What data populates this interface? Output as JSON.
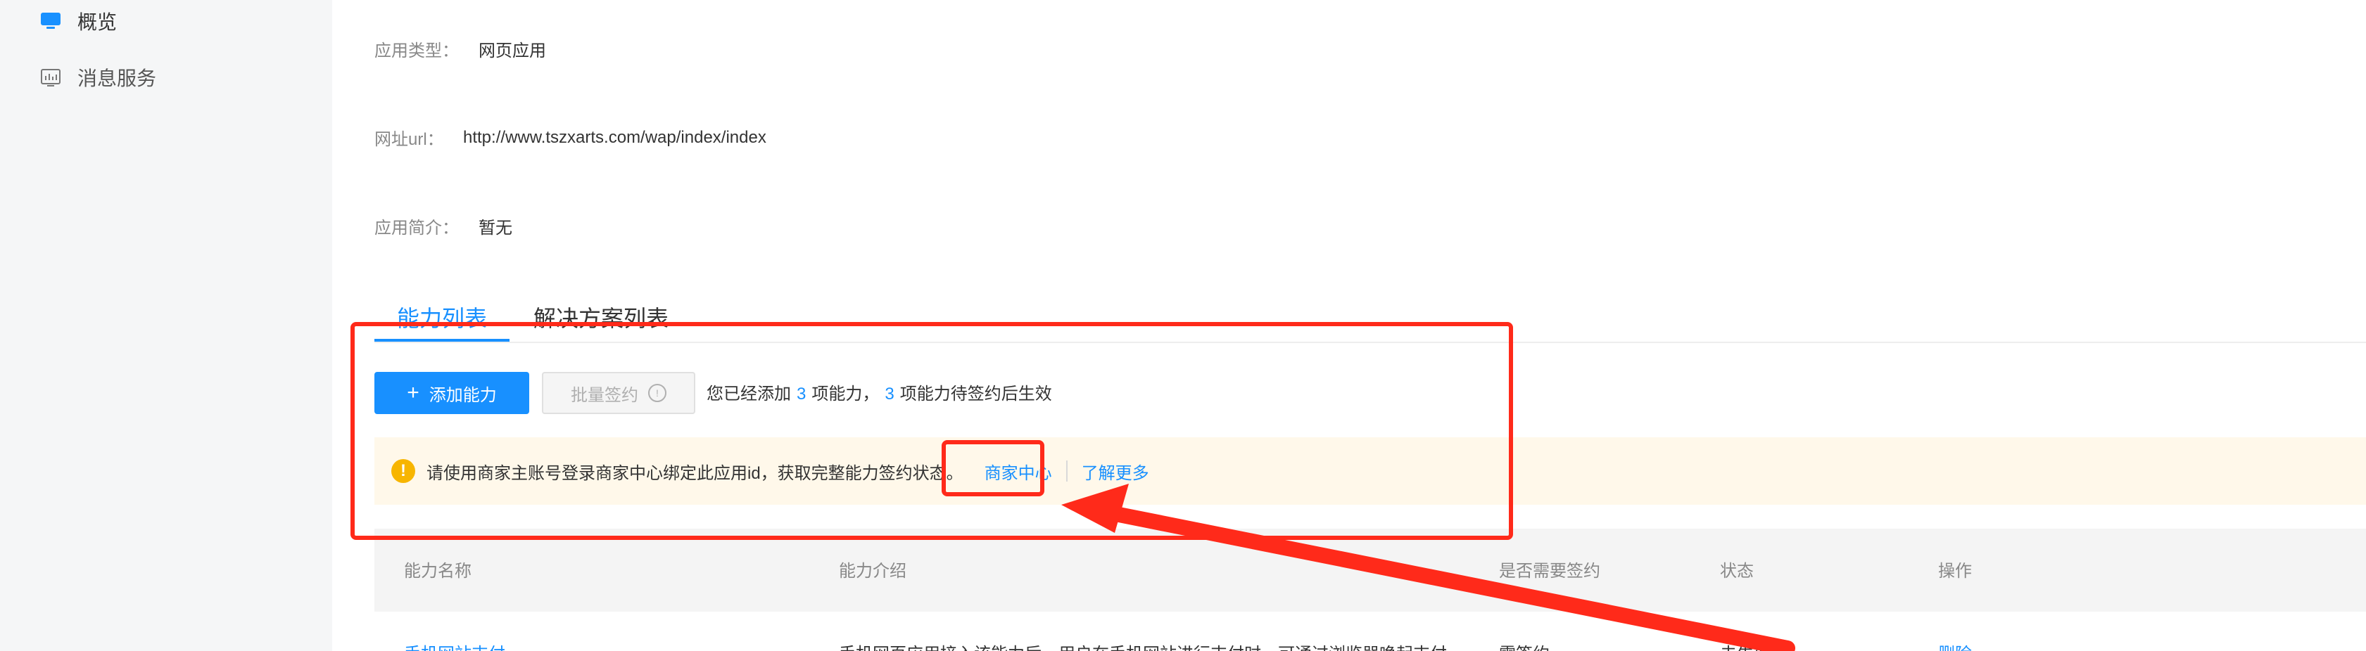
{
  "sidebar": {
    "items": [
      {
        "label": "概览",
        "icon": "monitor-icon"
      },
      {
        "label": "消息服务",
        "icon": "chart-icon"
      }
    ]
  },
  "app_info": {
    "type_label": "应用类型：",
    "type_value": "网页应用",
    "url_label": "网址url：",
    "url_value": "http://www.tszxarts.com/wap/index/index",
    "intro_label": "应用简介：",
    "intro_value": "暂无"
  },
  "tabs": [
    {
      "label": "能力列表"
    },
    {
      "label": "解决方案列表"
    }
  ],
  "toolbar": {
    "add_label": "添加能力",
    "batch_label": "批量签约",
    "summary_prefix": "您已经添加",
    "added_count": "3",
    "summary_mid": "项能力，",
    "pending_count": "3",
    "summary_suffix": "项能力待签约后生效"
  },
  "alert": {
    "text": "请使用商家主账号登录商家中心绑定此应用id，获取完整能力签约状态。",
    "link_merchant": "商家中心",
    "link_more": "了解更多"
  },
  "table": {
    "headers": [
      "能力名称",
      "能力介绍",
      "是否需要签约",
      "状态",
      "操作"
    ],
    "rows": [
      {
        "name": "手机网站支付",
        "intro": "手机网页应用接入该能力后，用户在手机网站进行支付时，可通过浏览器唤起支付...",
        "sign": "需签约",
        "status": "未生效",
        "action": "删除"
      }
    ]
  },
  "colors": {
    "accent": "#1890ff",
    "annotation": "#ff2a1a",
    "warning": "#f7b500"
  }
}
